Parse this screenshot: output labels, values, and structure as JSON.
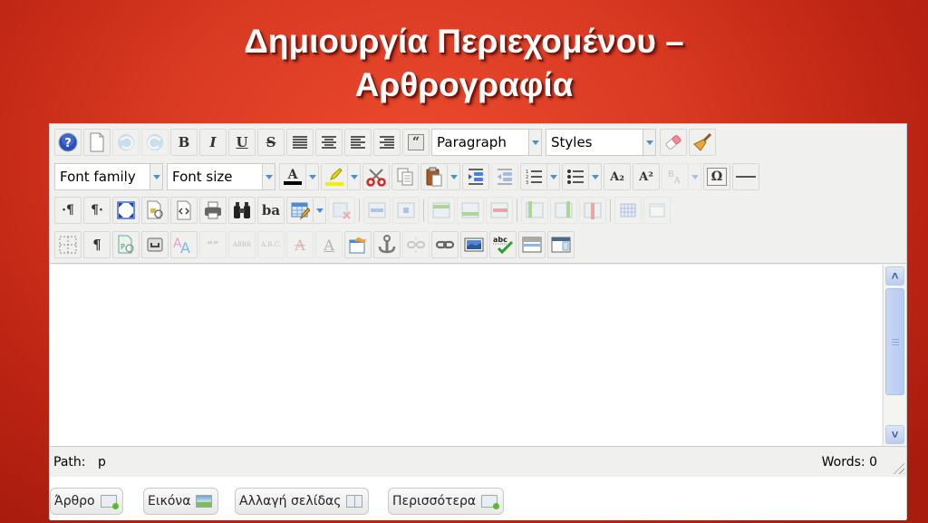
{
  "slide": {
    "title_line1": "Δημιουργία Περιεχομένου –",
    "title_line2": "Αρθρογραφία"
  },
  "toolbar": {
    "row1": [
      "help-icon",
      "new-document-icon",
      "undo-icon",
      "redo-icon",
      "bold-icon",
      "italic-icon",
      "underline-icon",
      "strikethrough-icon",
      "justify-full-icon",
      "justify-center-icon",
      "justify-left-icon",
      "justify-right-icon",
      "blockquote-icon",
      "format-select",
      "styles-select",
      "remove-format-icon",
      "cleanup-icon"
    ],
    "bold": "B",
    "italic": "I",
    "underline": "U",
    "strike": "S",
    "blockquote": "“",
    "format_select": "Paragraph",
    "styles_select": "Styles",
    "font_family_select": "Font family",
    "font_size_select": "Font size",
    "forecolor": "A",
    "subscript": "A₂",
    "superscript": "A²",
    "charmap": "Ω",
    "ltr": "·¶",
    "rtl": "¶·",
    "spellcheck": "abc",
    "visualchars": "¶",
    "replace": "ba",
    "abbr": "ABBR",
    "acronym": "A.B.C.",
    "cite": "“”",
    "letter_a": "A"
  },
  "statusbar": {
    "path_label": "Path:",
    "path_value": "p",
    "words": "Words: 0"
  },
  "bottom_buttons": [
    {
      "label": "Άρθρο",
      "icon": "article-icon"
    },
    {
      "label": "Εικόνα",
      "icon": "image-icon"
    },
    {
      "label": "Αλλαγή σελίδας",
      "icon": "pagebreak-icon"
    },
    {
      "label": "Περισσότερα",
      "icon": "readmore-icon"
    }
  ]
}
